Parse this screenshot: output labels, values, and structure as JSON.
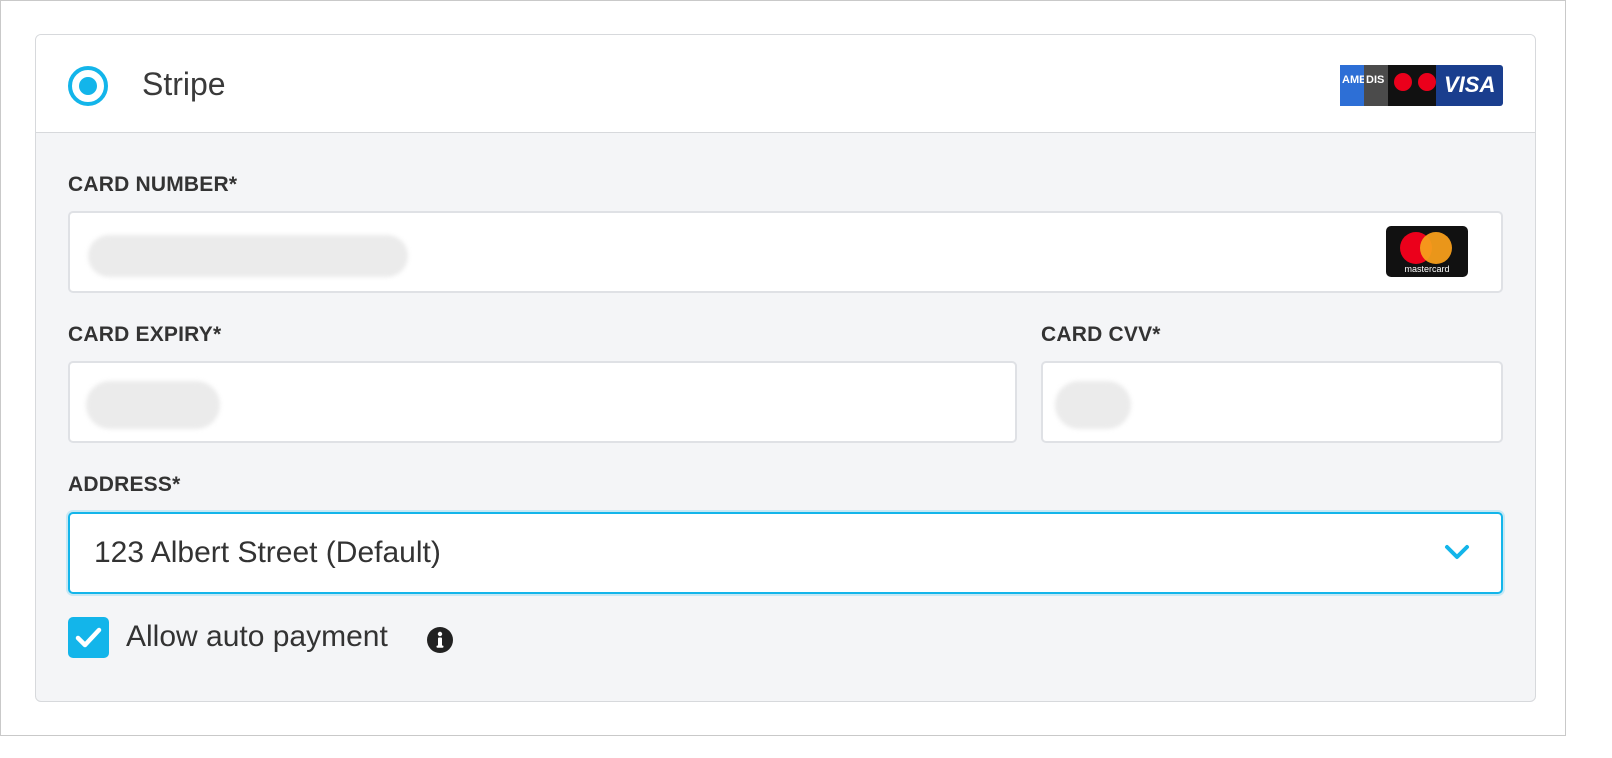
{
  "payment_method": {
    "provider_label": "Stripe",
    "selected": true,
    "card_brands": [
      "AMEX",
      "DISCOVER",
      "MASTERCARD",
      "MAESTRO",
      "VISA"
    ],
    "amex_text": "AME",
    "disc_text": "DIS",
    "visa_text": "VISA"
  },
  "fields": {
    "card_number_label": "CARD NUMBER*",
    "card_number_brand_text": "mastercard",
    "card_expiry_label": "CARD EXPIRY*",
    "card_cvv_label": "CARD CVV*",
    "address_label": "ADDRESS*",
    "address_value": "123 Albert Street (Default)"
  },
  "auto_payment": {
    "label": "Allow auto payment",
    "checked": true
  },
  "colors": {
    "accent": "#13b5ea",
    "panel_bg": "#f4f5f7",
    "text": "#333333"
  }
}
